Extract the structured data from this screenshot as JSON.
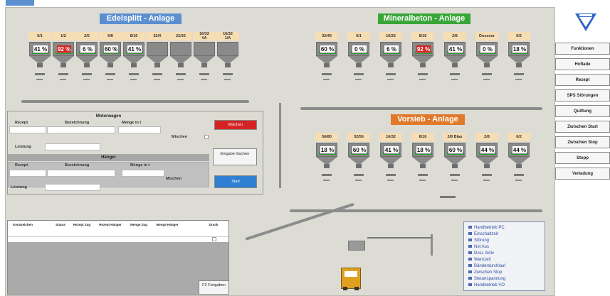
{
  "window": {
    "top_tab": ""
  },
  "plants": {
    "edelsplitt": {
      "title": "Edelsplitt - Anlage",
      "bins": [
        {
          "label": "0/1",
          "value": "41 %",
          "status": "ok"
        },
        {
          "label": "1/2",
          "value": "92 %",
          "status": "alarm"
        },
        {
          "label": "2/5",
          "value": "6 %",
          "status": "ok"
        },
        {
          "label": "5/8",
          "value": "60 %",
          "status": "ok"
        },
        {
          "label": "8/16",
          "value": "41 %",
          "status": "ok"
        },
        {
          "label": "32/X",
          "value": "",
          "status": "inactive"
        },
        {
          "label": "22/32",
          "value": "",
          "status": "inactive"
        },
        {
          "label": "16/32\nVA",
          "value": "",
          "status": "inactive"
        },
        {
          "label": "16/32\n1/A",
          "value": "",
          "status": "inactive"
        }
      ]
    },
    "mineralbeton": {
      "title": "Mineralbeton - Anlage",
      "bins": [
        {
          "label": "32/45",
          "value": "60 %",
          "status": "ok"
        },
        {
          "label": "0/1",
          "value": "0 %",
          "status": "ok"
        },
        {
          "label": "16/32",
          "value": "6 %",
          "status": "ok"
        },
        {
          "label": "8/16",
          "value": "92 %",
          "status": "alarm"
        },
        {
          "label": "2/8",
          "value": "41 %",
          "status": "ok"
        },
        {
          "label": "Dosseur",
          "value": "0 %",
          "status": "ok"
        },
        {
          "label": "0/2",
          "value": "18 %",
          "status": "ok"
        }
      ]
    },
    "vorsieb": {
      "title": "Vorsieb - Anlage",
      "bins": [
        {
          "label": "56/80",
          "value": "18 %",
          "status": "ok"
        },
        {
          "label": "32/56",
          "value": "60 %",
          "status": "ok"
        },
        {
          "label": "16/32",
          "value": "41 %",
          "status": "ok"
        },
        {
          "label": "8/16",
          "value": "18 %",
          "status": "ok"
        },
        {
          "label": "2/8 Blau",
          "value": "60 %",
          "status": "ok"
        },
        {
          "label": "2/8",
          "value": "44 %",
          "status": "ok"
        },
        {
          "label": "0/2",
          "value": "44 %",
          "status": "ok"
        }
      ]
    }
  },
  "order_form": {
    "motorwagen_title": "Motorwagen",
    "anhaenger_title": "Hänger",
    "col_rezept": "Rezept",
    "col_bezeichnung": "Bezeichnung",
    "col_menge": "Menge in t",
    "mischen_label": "Mischen",
    "leistung_label": "Leistung",
    "btn_red": "Mischen",
    "btn_clear": "Eingabe löschen",
    "btn_start": "Start"
  },
  "queue_table": {
    "columns": [
      "Kennzeichen",
      "Status",
      "Rezept Zug",
      "Rezept Hänger",
      "Menge Zug",
      "Menge Hänger",
      "Druck"
    ],
    "freigabe_button": "F2 Freigaben"
  },
  "sidebar": {
    "logo_text": "",
    "buttons": [
      "Funktionen",
      "Hoflade",
      "Rezept",
      "SPS Störungen",
      "Quittung",
      "Zwischen Start",
      "Zwischen Stop",
      "Stopp",
      "Verladung"
    ]
  },
  "legend": {
    "items": [
      "Handbetrieb PC",
      "Einschaltzeit",
      "Störung",
      "Not Aus",
      "Dosi. Aktiv",
      "Warnzeit",
      "Bänderdurchlauf",
      "Zwischen Stop",
      "Steuerspannung",
      "Handbetrieb VO"
    ]
  },
  "colors": {
    "green": "#2b9a2b",
    "red": "#d62424",
    "blue_title": "#5b8fd0",
    "green_title": "#3aa63a",
    "orange_title": "#e07a2a"
  }
}
